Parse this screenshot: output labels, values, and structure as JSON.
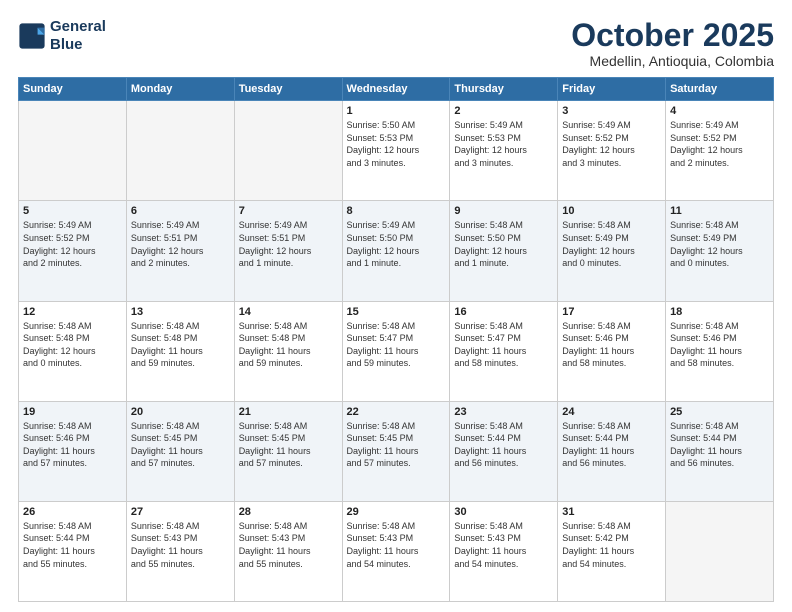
{
  "header": {
    "logo_line1": "General",
    "logo_line2": "Blue",
    "month_title": "October 2025",
    "subtitle": "Medellin, Antioquia, Colombia"
  },
  "weekdays": [
    "Sunday",
    "Monday",
    "Tuesday",
    "Wednesday",
    "Thursday",
    "Friday",
    "Saturday"
  ],
  "weeks": [
    {
      "shade": false,
      "days": [
        {
          "num": "",
          "info": ""
        },
        {
          "num": "",
          "info": ""
        },
        {
          "num": "",
          "info": ""
        },
        {
          "num": "1",
          "info": "Sunrise: 5:50 AM\nSunset: 5:53 PM\nDaylight: 12 hours\nand 3 minutes."
        },
        {
          "num": "2",
          "info": "Sunrise: 5:49 AM\nSunset: 5:53 PM\nDaylight: 12 hours\nand 3 minutes."
        },
        {
          "num": "3",
          "info": "Sunrise: 5:49 AM\nSunset: 5:52 PM\nDaylight: 12 hours\nand 3 minutes."
        },
        {
          "num": "4",
          "info": "Sunrise: 5:49 AM\nSunset: 5:52 PM\nDaylight: 12 hours\nand 2 minutes."
        }
      ]
    },
    {
      "shade": true,
      "days": [
        {
          "num": "5",
          "info": "Sunrise: 5:49 AM\nSunset: 5:52 PM\nDaylight: 12 hours\nand 2 minutes."
        },
        {
          "num": "6",
          "info": "Sunrise: 5:49 AM\nSunset: 5:51 PM\nDaylight: 12 hours\nand 2 minutes."
        },
        {
          "num": "7",
          "info": "Sunrise: 5:49 AM\nSunset: 5:51 PM\nDaylight: 12 hours\nand 1 minute."
        },
        {
          "num": "8",
          "info": "Sunrise: 5:49 AM\nSunset: 5:50 PM\nDaylight: 12 hours\nand 1 minute."
        },
        {
          "num": "9",
          "info": "Sunrise: 5:48 AM\nSunset: 5:50 PM\nDaylight: 12 hours\nand 1 minute."
        },
        {
          "num": "10",
          "info": "Sunrise: 5:48 AM\nSunset: 5:49 PM\nDaylight: 12 hours\nand 0 minutes."
        },
        {
          "num": "11",
          "info": "Sunrise: 5:48 AM\nSunset: 5:49 PM\nDaylight: 12 hours\nand 0 minutes."
        }
      ]
    },
    {
      "shade": false,
      "days": [
        {
          "num": "12",
          "info": "Sunrise: 5:48 AM\nSunset: 5:48 PM\nDaylight: 12 hours\nand 0 minutes."
        },
        {
          "num": "13",
          "info": "Sunrise: 5:48 AM\nSunset: 5:48 PM\nDaylight: 11 hours\nand 59 minutes."
        },
        {
          "num": "14",
          "info": "Sunrise: 5:48 AM\nSunset: 5:48 PM\nDaylight: 11 hours\nand 59 minutes."
        },
        {
          "num": "15",
          "info": "Sunrise: 5:48 AM\nSunset: 5:47 PM\nDaylight: 11 hours\nand 59 minutes."
        },
        {
          "num": "16",
          "info": "Sunrise: 5:48 AM\nSunset: 5:47 PM\nDaylight: 11 hours\nand 58 minutes."
        },
        {
          "num": "17",
          "info": "Sunrise: 5:48 AM\nSunset: 5:46 PM\nDaylight: 11 hours\nand 58 minutes."
        },
        {
          "num": "18",
          "info": "Sunrise: 5:48 AM\nSunset: 5:46 PM\nDaylight: 11 hours\nand 58 minutes."
        }
      ]
    },
    {
      "shade": true,
      "days": [
        {
          "num": "19",
          "info": "Sunrise: 5:48 AM\nSunset: 5:46 PM\nDaylight: 11 hours\nand 57 minutes."
        },
        {
          "num": "20",
          "info": "Sunrise: 5:48 AM\nSunset: 5:45 PM\nDaylight: 11 hours\nand 57 minutes."
        },
        {
          "num": "21",
          "info": "Sunrise: 5:48 AM\nSunset: 5:45 PM\nDaylight: 11 hours\nand 57 minutes."
        },
        {
          "num": "22",
          "info": "Sunrise: 5:48 AM\nSunset: 5:45 PM\nDaylight: 11 hours\nand 57 minutes."
        },
        {
          "num": "23",
          "info": "Sunrise: 5:48 AM\nSunset: 5:44 PM\nDaylight: 11 hours\nand 56 minutes."
        },
        {
          "num": "24",
          "info": "Sunrise: 5:48 AM\nSunset: 5:44 PM\nDaylight: 11 hours\nand 56 minutes."
        },
        {
          "num": "25",
          "info": "Sunrise: 5:48 AM\nSunset: 5:44 PM\nDaylight: 11 hours\nand 56 minutes."
        }
      ]
    },
    {
      "shade": false,
      "days": [
        {
          "num": "26",
          "info": "Sunrise: 5:48 AM\nSunset: 5:44 PM\nDaylight: 11 hours\nand 55 minutes."
        },
        {
          "num": "27",
          "info": "Sunrise: 5:48 AM\nSunset: 5:43 PM\nDaylight: 11 hours\nand 55 minutes."
        },
        {
          "num": "28",
          "info": "Sunrise: 5:48 AM\nSunset: 5:43 PM\nDaylight: 11 hours\nand 55 minutes."
        },
        {
          "num": "29",
          "info": "Sunrise: 5:48 AM\nSunset: 5:43 PM\nDaylight: 11 hours\nand 54 minutes."
        },
        {
          "num": "30",
          "info": "Sunrise: 5:48 AM\nSunset: 5:43 PM\nDaylight: 11 hours\nand 54 minutes."
        },
        {
          "num": "31",
          "info": "Sunrise: 5:48 AM\nSunset: 5:42 PM\nDaylight: 11 hours\nand 54 minutes."
        },
        {
          "num": "",
          "info": ""
        }
      ]
    }
  ]
}
